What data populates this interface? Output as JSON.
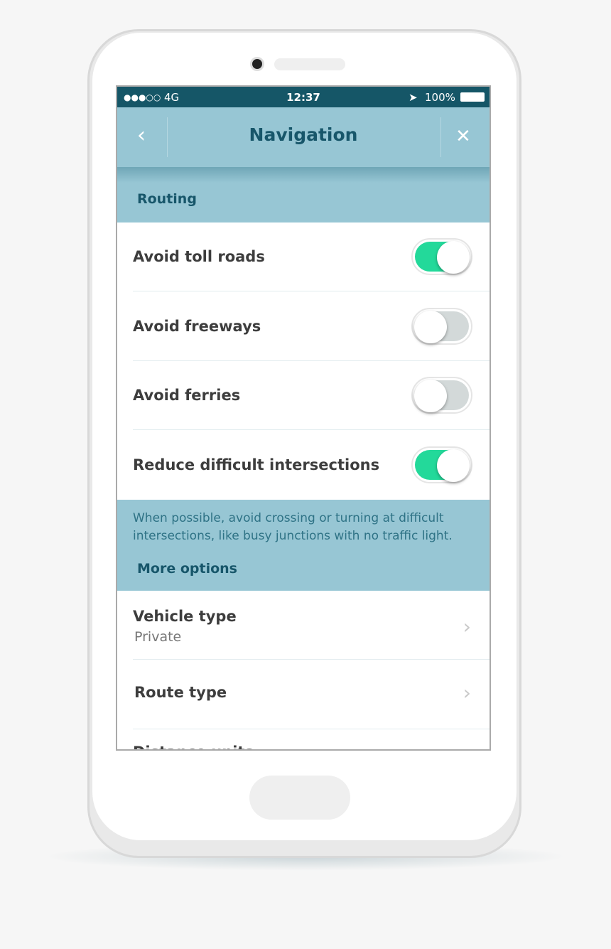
{
  "status_bar": {
    "signal": "●●●○○",
    "network": "4G",
    "time": "12:37",
    "battery": "100%"
  },
  "header": {
    "title": "Navigation",
    "back_icon": "‹",
    "close_icon": "✕"
  },
  "routing": {
    "label": "Routing",
    "items": [
      {
        "label": "Avoid toll roads",
        "on": true
      },
      {
        "label": "Avoid freeways",
        "on": false
      },
      {
        "label": "Avoid ferries",
        "on": false
      },
      {
        "label": "Reduce difficult intersections",
        "on": true
      }
    ],
    "note": "When possible, avoid crossing or turning at difficult intersections, like busy junctions with no traffic light."
  },
  "more_options": {
    "label": "More options",
    "items": [
      {
        "label": "Vehicle type",
        "value": "Private"
      },
      {
        "label": "Route type"
      },
      {
        "label": "Distance units"
      }
    ]
  },
  "colors": {
    "accent": "#23d99a",
    "toggle_off": "#d3d9d9",
    "status_bar": "#155667",
    "header": "#97c6d4"
  }
}
